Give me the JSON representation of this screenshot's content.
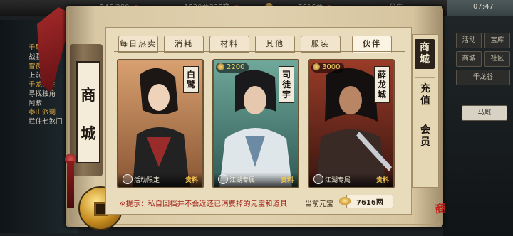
{
  "topbar": {
    "energy": "246/280",
    "silver": "1530两335文",
    "gold": "7616两",
    "announcement": "公告",
    "clock": "07:47"
  },
  "quests": [
    {
      "title": "千里追",
      "desc": "战胜双刀"
    },
    {
      "title": "雪夜寻",
      "desc": "上前一观"
    },
    {
      "title": "千龙谷主",
      "desc": "寻找独角"
    },
    {
      "title": "",
      "desc": "阿紫"
    },
    {
      "title": "泰山派剩",
      "desc": "拦住七煞门"
    }
  ],
  "right_menu": [
    "活动",
    "宝库",
    "商城",
    "社区",
    "千龙谷"
  ],
  "right_extra": "马厩",
  "shop": {
    "title_chars": [
      "商",
      "城"
    ],
    "tabs": [
      "每日热卖",
      "消耗",
      "材料",
      "其他",
      "服装",
      "伙伴"
    ],
    "active_tab": 5,
    "cards": [
      {
        "name": "白鹭",
        "price": "",
        "tag": "活动限定",
        "quality": "贵料",
        "theme": "#c8875a"
      },
      {
        "name": "司徒宇",
        "price": "2200",
        "tag": "江湖专属",
        "quality": "贵料",
        "theme": "#4f8a7e"
      },
      {
        "name": "薛龙城",
        "price": "3000",
        "tag": "江湖专属",
        "quality": "贵料",
        "theme": "#7a2a1f"
      }
    ],
    "side_nav": [
      "商城",
      "充值",
      "会员"
    ],
    "tip": "※提示：私自回档并不会返还已消费掉的元宝和道具",
    "balance_label": "当前元宝",
    "balance": "7616两"
  },
  "seal": "商"
}
